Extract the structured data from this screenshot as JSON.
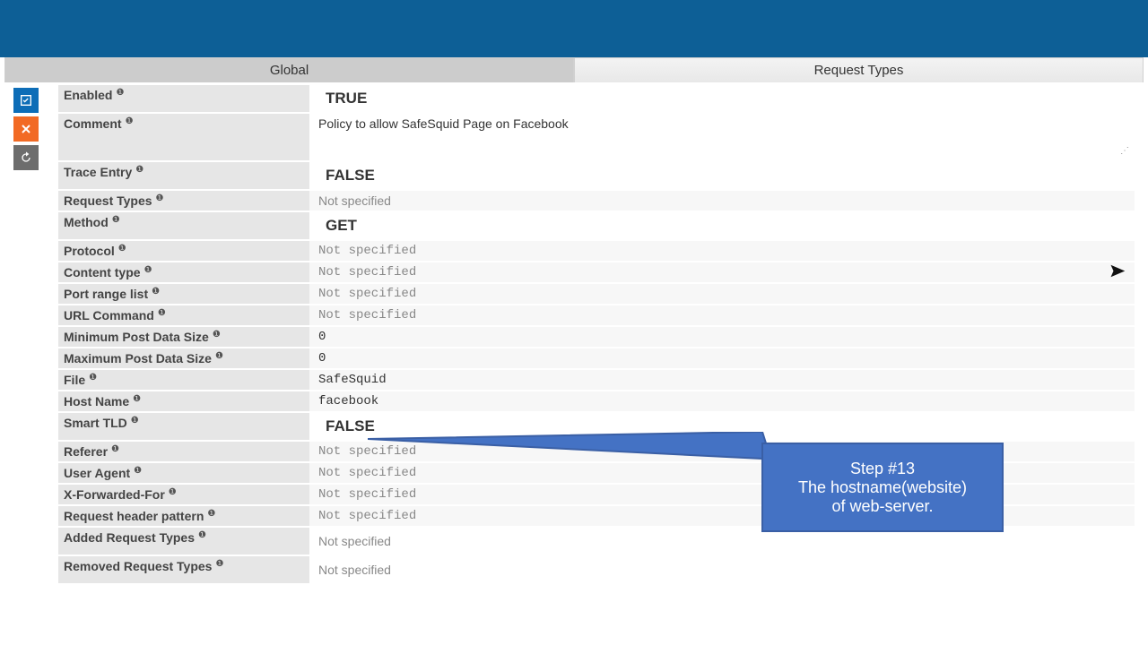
{
  "tabs": {
    "global": "Global",
    "request_types": "Request Types"
  },
  "side": {
    "confirm": "confirm",
    "cancel": "cancel",
    "undo": "undo"
  },
  "fields": {
    "enabled_label": "Enabled",
    "enabled_value": "TRUE",
    "comment_label": "Comment",
    "comment_value": "Policy to allow SafeSquid Page on Facebook",
    "trace_label": "Trace Entry",
    "trace_value": "FALSE",
    "reqtypes_label": "Request Types",
    "reqtypes_value": "Not specified",
    "method_label": "Method",
    "method_value": "GET",
    "protocol_label": "Protocol",
    "protocol_value": "Not specified",
    "ctype_label": "Content type",
    "ctype_value": "Not specified",
    "port_label": "Port range list",
    "port_value": "Not specified",
    "urlcmd_label": "URL Command",
    "urlcmd_value": "Not specified",
    "minpost_label": "Minimum Post Data Size",
    "minpost_value": "0",
    "maxpost_label": "Maximum Post Data Size",
    "maxpost_value": "0",
    "file_label": "File",
    "file_value": "SafeSquid",
    "host_label": "Host Name",
    "host_value": "facebook",
    "stld_label": "Smart TLD",
    "stld_value": "FALSE",
    "referer_label": "Referer",
    "referer_value": "Not specified",
    "ua_label": "User Agent",
    "ua_value": "Not specified",
    "xff_label": "X-Forwarded-For",
    "xff_value": "Not specified",
    "rhp_label": "Request header pattern",
    "rhp_value": "Not specified",
    "art_label": "Added Request Types",
    "art_value": "Not specified",
    "rrt_label": "Removed Request Types",
    "rrt_value": "Not specified"
  },
  "callout": {
    "line1": "Step #13",
    "line2": "The hostname(website)",
    "line3": "of web-server."
  }
}
